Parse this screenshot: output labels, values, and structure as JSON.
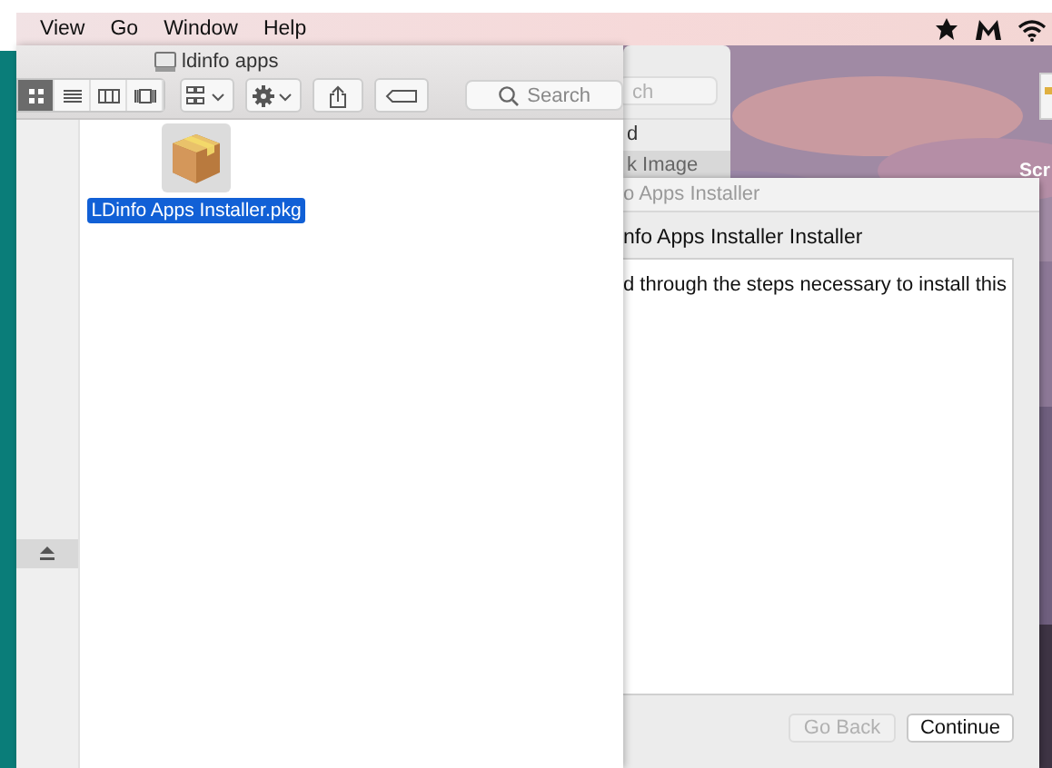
{
  "menu_bar": {
    "items": [
      {
        "label": "View"
      },
      {
        "label": "Go"
      },
      {
        "label": "Window"
      },
      {
        "label": "Help"
      }
    ]
  },
  "finder": {
    "title": "ldinfo apps",
    "view_modes": [
      {
        "kind": "icons",
        "selected": true
      },
      {
        "kind": "list",
        "selected": false
      },
      {
        "kind": "columns",
        "selected": false
      },
      {
        "kind": "gallery",
        "selected": false
      }
    ],
    "search": {
      "placeholder": "Search"
    },
    "files": [
      {
        "name": "LDinfo Apps Installer.pkg",
        "selected": true
      }
    ]
  },
  "back_window": {
    "search": {
      "placeholder": "ch"
    },
    "rows": [
      {
        "label": "d",
        "selected": false
      },
      {
        "label": "k Image",
        "selected": true
      }
    ]
  },
  "desktop": {
    "items": [
      {
        "label": "Scr"
      }
    ]
  },
  "installer": {
    "title": "o Apps Installer",
    "heading": "nfo Apps Installer Installer",
    "body": "d through the steps necessary to install this",
    "buttons": [
      {
        "label": "Go Back",
        "disabled": true
      },
      {
        "label": "Continue",
        "disabled": false
      }
    ]
  }
}
